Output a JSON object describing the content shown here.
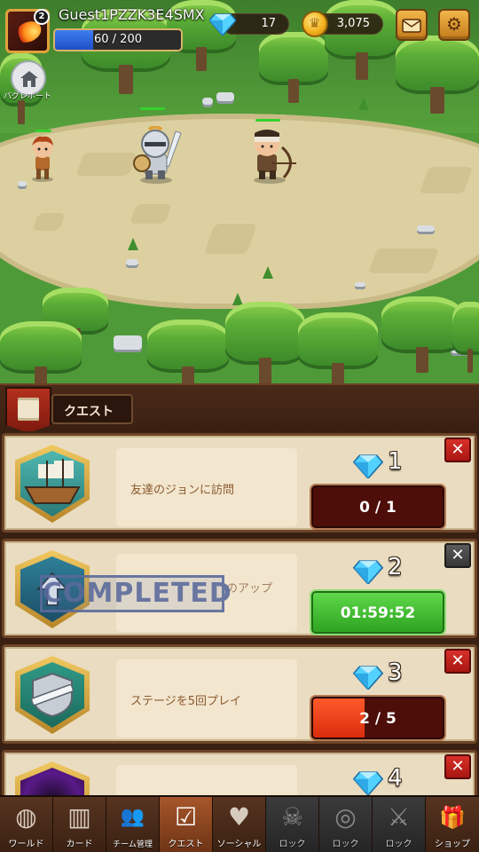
{
  "player": {
    "name": "Guest1PZZK3E4SMX",
    "level": "2",
    "exp_text": "60 / 200",
    "exp_fraction": 0.3
  },
  "currencies": {
    "gems": "17",
    "coins": "3,075"
  },
  "bug_report_label": "バグレポート",
  "quest_header": {
    "title": "クエスト"
  },
  "quests": [
    {
      "text": "友達のジョンに訪問",
      "reward": "1",
      "progress": "0 / 1",
      "progress_fraction": 0,
      "status": "in-progress"
    },
    {
      "text": "のアップ",
      "reward": "2",
      "progress": "01:59:52",
      "progress_fraction": 1,
      "status": "completed",
      "stamp": "COMPLETED"
    },
    {
      "text": "ステージを5回プレイ",
      "reward": "3",
      "progress": "2 / 5",
      "progress_fraction": 0.4,
      "status": "in-progress"
    },
    {
      "text": "",
      "reward": "4",
      "progress": "",
      "progress_fraction": 0,
      "status": "in-progress"
    }
  ],
  "colors": {
    "accent_green": "#2ea321",
    "accent_red": "#d92d0e",
    "panel": "#eadcc0",
    "frame": "#6e4528"
  },
  "nav": [
    {
      "label": "ワールド",
      "icon": "globe-icon",
      "glyph": "◍",
      "state": "normal"
    },
    {
      "label": "カード",
      "icon": "book-icon",
      "glyph": "▥",
      "state": "normal"
    },
    {
      "label": "チーム管理",
      "icon": "team-icon",
      "glyph": "👥",
      "state": "normal"
    },
    {
      "label": "クエスト",
      "icon": "checklist-icon",
      "glyph": "☑",
      "state": "active"
    },
    {
      "label": "ソーシャル",
      "icon": "heart-icon",
      "glyph": "♥",
      "state": "normal"
    },
    {
      "label": "ロック",
      "icon": "skull-icon",
      "glyph": "☠",
      "state": "locked"
    },
    {
      "label": "ロック",
      "icon": "target-icon",
      "glyph": "◎",
      "state": "locked"
    },
    {
      "label": "ロック",
      "icon": "crossed-swords-icon",
      "glyph": "⚔",
      "state": "locked"
    },
    {
      "label": "ショップ",
      "icon": "gift-icon",
      "glyph": "🎁",
      "state": "normal"
    }
  ]
}
